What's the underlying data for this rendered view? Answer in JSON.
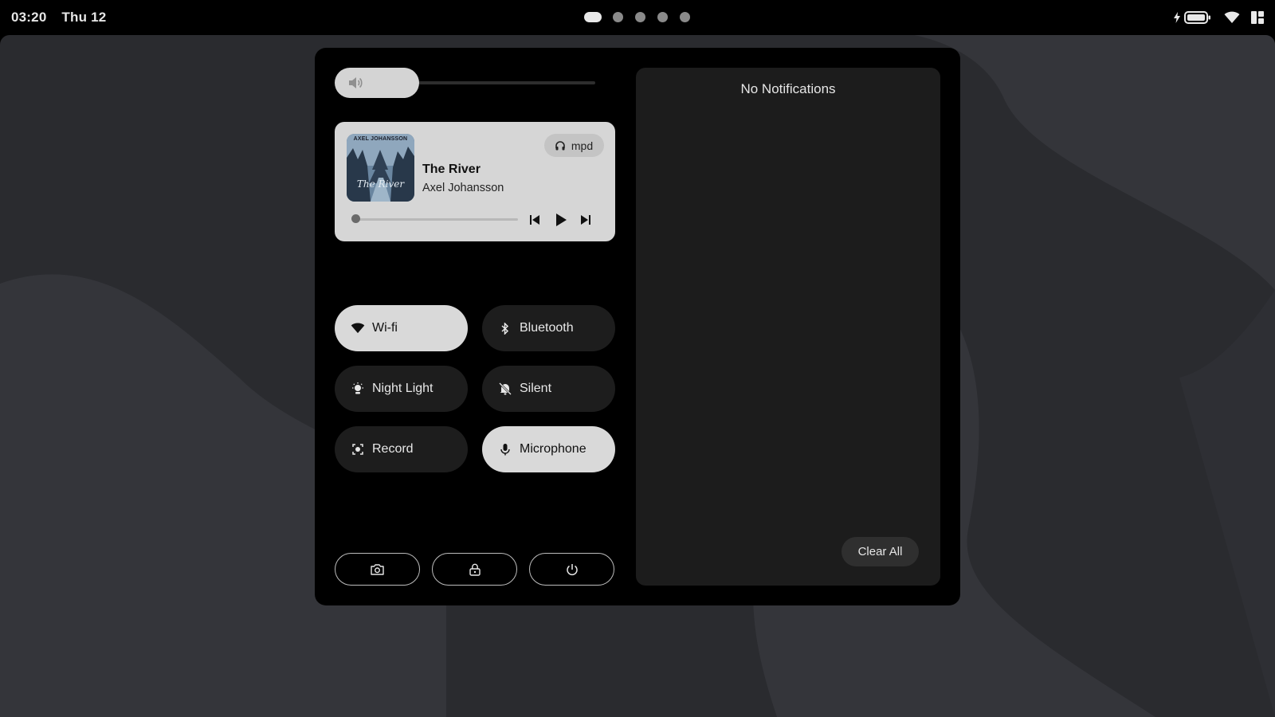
{
  "topbar": {
    "time": "03:20",
    "date": "Thu 12",
    "workspaces": [
      {
        "active": true
      },
      {
        "active": false
      },
      {
        "active": false
      },
      {
        "active": false
      },
      {
        "active": false
      }
    ],
    "tray_icons": [
      "charging-icon",
      "battery-icon",
      "wifi-icon",
      "layout-icon"
    ]
  },
  "quick_settings": {
    "volume": {
      "level": 0.0,
      "icon": "speaker-icon"
    },
    "media": {
      "source": "mpd",
      "source_icon": "headphones-icon",
      "title": "The River",
      "artist": "Axel Johansson",
      "cover_artist_text": "AXEL JOHANSSON",
      "cover_title_text": "The River",
      "progress": 0.0
    },
    "toggles": [
      {
        "label": "Wi-fi",
        "icon": "wifi-icon",
        "on": true
      },
      {
        "label": "Bluetooth",
        "icon": "bluetooth-icon",
        "on": false
      },
      {
        "label": "Night Light",
        "icon": "night-light-icon",
        "on": false
      },
      {
        "label": "Silent",
        "icon": "bell-off-icon",
        "on": false
      },
      {
        "label": "Record",
        "icon": "screen-record-icon",
        "on": false
      },
      {
        "label": "Microphone",
        "icon": "microphone-icon",
        "on": true
      }
    ],
    "actions": [
      "screenshot-icon",
      "lock-icon",
      "power-icon"
    ]
  },
  "notifications": {
    "empty_text": "No Notifications",
    "clear_label": "Clear All"
  },
  "colors": {
    "panel": "#000000",
    "tile_off": "#1d1d1d",
    "tile_on": "#d9d9d9",
    "wallpaper": "#2a2b2f"
  }
}
